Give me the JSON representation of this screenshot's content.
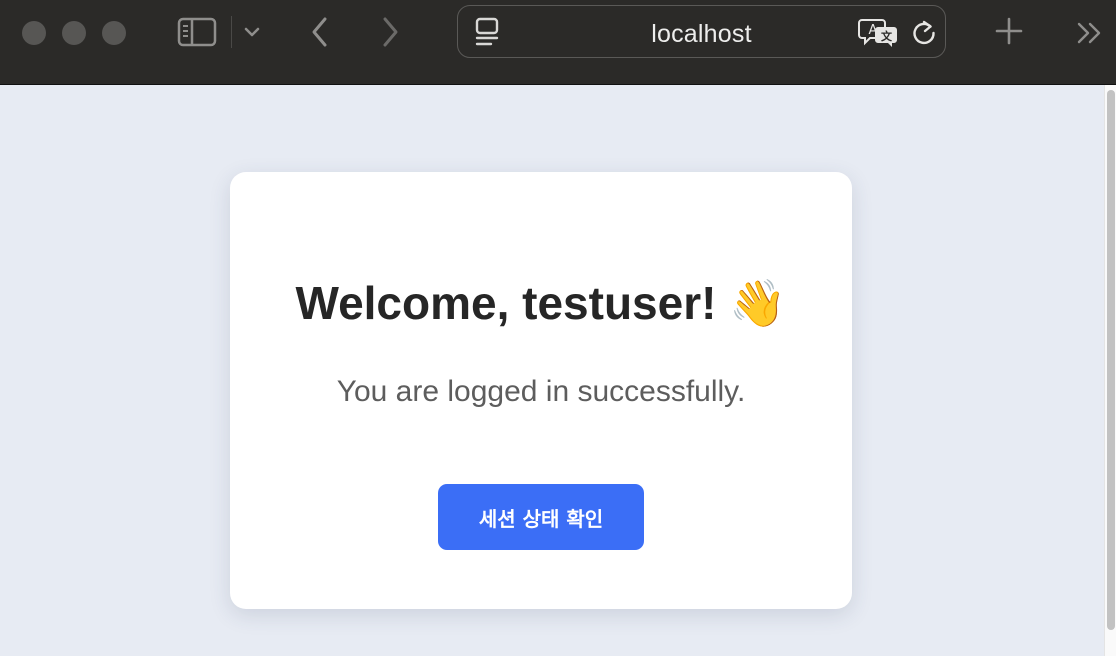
{
  "browser": {
    "address": "localhost",
    "icons": {
      "sidebar": "sidebar-icon",
      "tab_overview": "chevron-down-icon",
      "back": "back-arrow-icon",
      "forward": "forward-arrow-icon",
      "page_menu": "page-menu-icon",
      "translate": "translate-icon",
      "reload": "reload-icon",
      "new_tab": "plus-icon",
      "more": "double-chevron-icon"
    }
  },
  "page": {
    "background_color": "#e7ebf3",
    "card": {
      "title": "Welcome, testuser! 👋",
      "subtitle": "You are logged in successfully.",
      "button_label": "세션 상태 확인",
      "button_color": "#3b6ef6"
    }
  }
}
